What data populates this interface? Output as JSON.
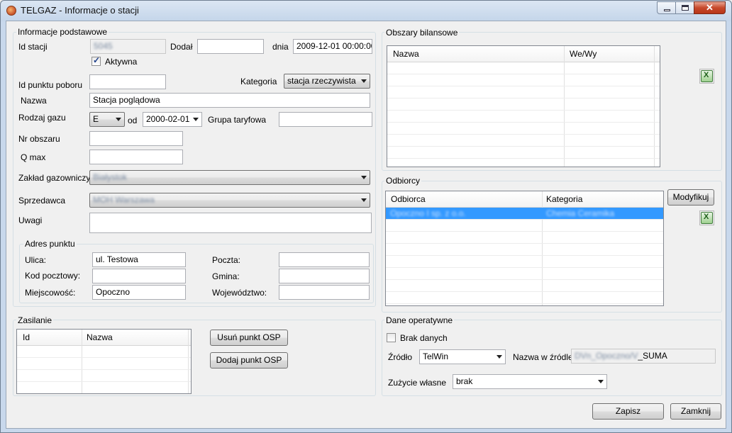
{
  "window": {
    "title": "TELGAZ - Informacje o stacji",
    "close_glyph": "✕"
  },
  "basic": {
    "group_label": "Informacje podstawowe",
    "id_stacji_label": "Id stacji",
    "id_stacji_value": "5045",
    "dodal_label": "Dodał",
    "dodal_value": "",
    "dnia_label": "dnia",
    "dnia_value": "2009-12-01 00:00:00",
    "aktywna_label": "Aktywna",
    "id_punktu_label": "Id punktu poboru",
    "id_punktu_value": "",
    "kategoria_label": "Kategoria",
    "kategoria_value": "stacja rzeczywista",
    "nazwa_label": "Nazwa",
    "nazwa_value": "Stacja poglądowa",
    "rodzaj_gazu_label": "Rodzaj gazu",
    "rodzaj_gazu_value": "E",
    "od_label": "od",
    "od_value": "2000-02-01",
    "grupa_label": "Grupa taryfowa",
    "grupa_value": "",
    "nr_obszaru_label": "Nr obszaru",
    "nr_obszaru_value": "",
    "qmax_label": "Q max",
    "qmax_value": "",
    "zaklad_label": "Zakład gazowniczy",
    "zaklad_value": "Białystok",
    "sprzedawca_label": "Sprzedawca",
    "sprzedawca_value": "MOH Warszawa",
    "uwagi_label": "Uwagi",
    "uwagi_value": ""
  },
  "address": {
    "group_label": "Adres punktu",
    "ulica_label": "Ulica:",
    "ulica_value": "ul. Testowa",
    "kod_label": "Kod pocztowy:",
    "kod_value": "",
    "miejscowosc_label": "Miejscowość:",
    "miejscowosc_value": "Opoczno",
    "poczta_label": "Poczta:",
    "poczta_value": "",
    "gmina_label": "Gmina:",
    "gmina_value": "",
    "wojewodztwo_label": "Województwo:",
    "wojewodztwo_value": ""
  },
  "zasilanie": {
    "group_label": "Zasilanie",
    "col_id": "Id",
    "col_nazwa": "Nazwa",
    "remove_button": "Usuń punkt OSP",
    "add_button": "Dodaj punkt OSP"
  },
  "obszary": {
    "group_label": "Obszary bilansowe",
    "col_nazwa": "Nazwa",
    "col_wewy": "We/Wy"
  },
  "odbiorcy": {
    "group_label": "Odbiorcy",
    "col_odbiorca": "Odbiorca",
    "col_kategoria": "Kategoria",
    "modify_button": "Modyfikuj",
    "rows": [
      {
        "odbiorca": "Opoczno I sp. z o.o.",
        "kategoria": "Chemia Ceramika"
      }
    ]
  },
  "operational": {
    "group_label": "Dane operatywne",
    "brak_label": "Brak danych",
    "zrodlo_label": "Źródło",
    "zrodlo_value": "TelWin",
    "nazwa_zrodle_label": "Nazwa w źródle",
    "nazwa_zrodle_prefix": "DVn_Opoczno/V",
    "nazwa_zrodle_suffix": "_SUMA",
    "zuzycie_label": "Zużycie własne",
    "zuzycie_value": "brak"
  },
  "footer": {
    "save_button": "Zapisz",
    "close_button": "Zamknij"
  },
  "icons": {
    "app": "flame-icon",
    "export": "excel-icon"
  },
  "colors": {
    "selection": "#3399ff"
  }
}
